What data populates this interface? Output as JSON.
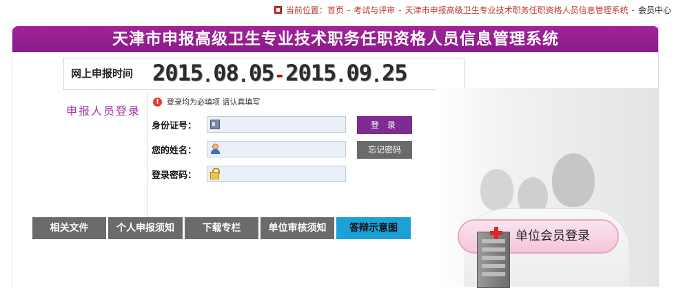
{
  "breadcrumb": {
    "prefix": "当前位置：",
    "items": [
      "首页",
      "考试与评审",
      "天津市申报高级卫生专业技术职务任职资格人员信息管理系统",
      "会员中心"
    ],
    "separator": "-"
  },
  "header": {
    "title": "天津市申报高级卫生专业技术职务任职资格人员信息管理系统"
  },
  "apply_period": {
    "label": "网上申报时间",
    "start": {
      "year": "2015",
      "month": "08",
      "day": "05"
    },
    "end": {
      "year": "2015",
      "month": "09",
      "day": "25"
    },
    "dot": ".",
    "dash": "-"
  },
  "login": {
    "section_label": "申报人员登录",
    "notice": "登录均为必填项 请认真填写",
    "id_label": "身份证号：",
    "name_label": "您的姓名：",
    "password_label": "登录密码：",
    "id_value": "",
    "name_value": "",
    "password_value": "",
    "login_button": "登 录",
    "forgot_button": "忘记密码"
  },
  "nav": {
    "items": [
      {
        "label": "相关文件"
      },
      {
        "label": "个人申报须知"
      },
      {
        "label": "下载专栏"
      },
      {
        "label": "单位审核须知"
      },
      {
        "label": "答辩示意图"
      }
    ]
  },
  "member_login": {
    "label": "单位会员登录"
  },
  "colors": {
    "brand": "#8a1b88",
    "nav_bg": "#6b6b6b",
    "nav_active": "#1ba0d8",
    "date_dash": "#c40000"
  }
}
